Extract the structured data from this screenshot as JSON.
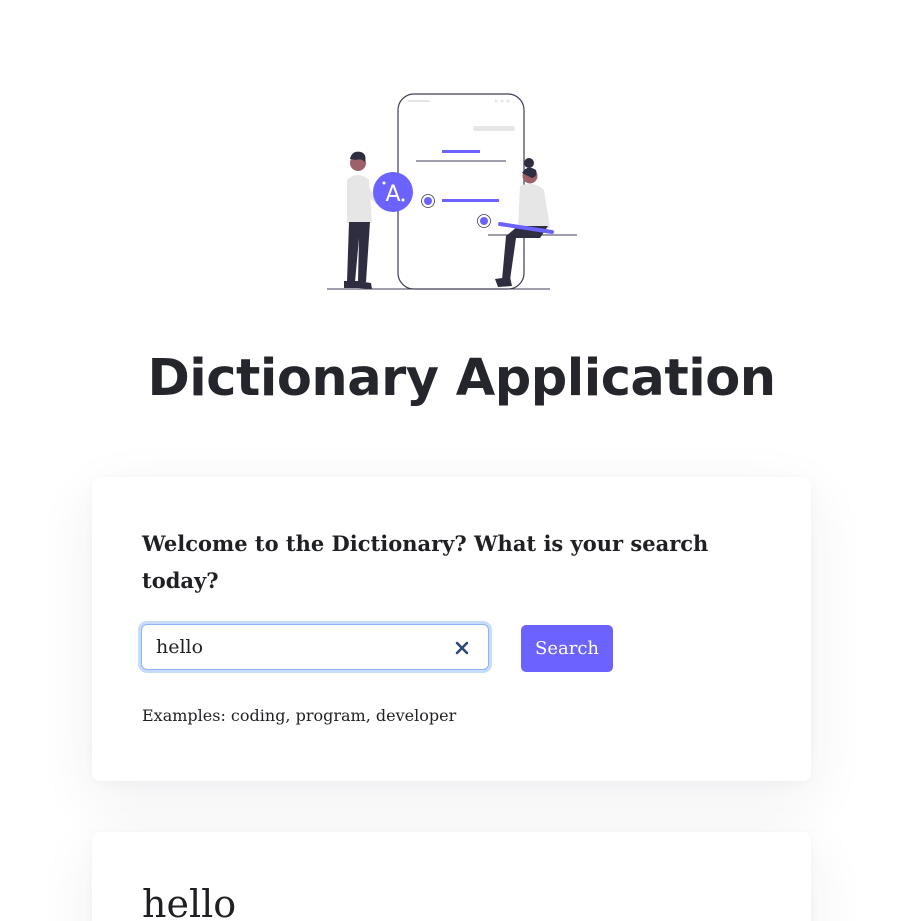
{
  "header": {
    "title": "Dictionary Application",
    "illustration_badge": "A"
  },
  "search": {
    "prompt": "Welcome to the Dictionary? What is your search today?",
    "value": "hello",
    "button_label": "Search",
    "examples": "Examples: coding, program, developer"
  },
  "result": {
    "word": "hello"
  },
  "colors": {
    "accent": "#6c63ff",
    "title": "#24262b",
    "clear_icon": "#2f4a7a",
    "input_focus_ring": "#c7dcfb"
  },
  "icons": {
    "clear": "close-icon"
  }
}
